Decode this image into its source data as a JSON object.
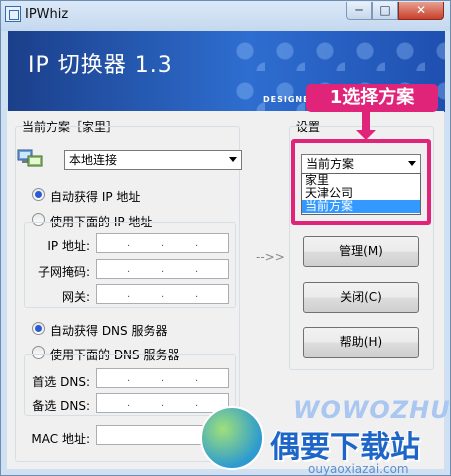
{
  "window": {
    "title": "IPWhiz",
    "min_label": "─",
    "max_label": "□",
    "close_label": "✕"
  },
  "banner": {
    "title": "IP 切换器 1.3",
    "designed": "DESIGNED"
  },
  "callout": {
    "text": "1选择方案"
  },
  "scheme": {
    "label": "当前方案［家里］",
    "connection": "本地连接"
  },
  "ip": {
    "auto_label": "自动获得 IP 地址",
    "manual_label": "使用下面的 IP 地址",
    "auto_selected": true,
    "fields": {
      "ip": "IP 地址:",
      "mask": "子网掩码:",
      "gateway": "网关:"
    }
  },
  "dns": {
    "auto_label": "自动获得 DNS 服务器",
    "manual_label": "使用下面的 DNS 服务器",
    "auto_selected": true,
    "fields": {
      "primary": "首选 DNS:",
      "secondary": "备选 DNS:"
    }
  },
  "mac": {
    "label": "MAC 地址:"
  },
  "arrow_text": "-->>",
  "settings": {
    "label": "设置",
    "selected": "当前方案",
    "options": [
      "家里",
      "天津公司",
      "当前方案"
    ]
  },
  "buttons": {
    "manage": "管理(M)",
    "close": "关闭(C)",
    "help": "帮助(H)"
  },
  "watermark": {
    "brand": "WOWOZHU",
    "name": "偶要下载站",
    "url": "ouyaoxiazai.com"
  },
  "colors": {
    "accent": "#e0247a",
    "selection": "#3399ff",
    "banner": "#2e6ed0"
  }
}
